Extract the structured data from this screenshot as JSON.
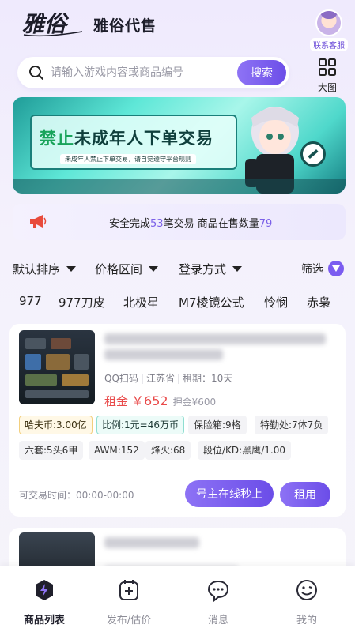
{
  "header": {
    "logo_text": "雅俗",
    "app_title": "雅俗代售",
    "customer_service": "联系客服"
  },
  "search": {
    "placeholder": "请输入游戏内容或商品编号",
    "button": "搜索",
    "view_toggle": "大图"
  },
  "banner": {
    "title_accent": "禁止",
    "title_rest": "未成年人下单交易",
    "subtitle": "未成年人禁止下单交易，请自觉遵守平台规则"
  },
  "notice": {
    "prefix": "安全完成",
    "completed_count": "53",
    "middle": "笔交易 商品在售数量",
    "on_sale_count": "79"
  },
  "filters": {
    "items": [
      "默认排序",
      "价格区间",
      "登录方式"
    ],
    "screen": "筛选"
  },
  "tags": [
    "977",
    "977刀皮",
    "北极星",
    "M7棱镜公式",
    "怜悯",
    "赤枭"
  ],
  "listing": {
    "meta": [
      "QQ扫码",
      "江苏省",
      "租期：10天"
    ],
    "price_label": "租金",
    "price": "￥652",
    "deposit": "押金¥600",
    "chips": [
      "哈夫币:3.00亿",
      "比例:1元=46万币",
      "保险箱:9格",
      "特勤处:7体7负",
      "六套:5头6甲",
      "AWM:152",
      "烽火:68",
      "段位/KD:黑鹰/1.00"
    ],
    "trade_time": "可交易时间：00:00-00:00",
    "btn_online": "号主在线秒上",
    "btn_rent": "租用"
  },
  "tabbar": [
    "商品列表",
    "发布/估价",
    "消息",
    "我的"
  ],
  "colors": {
    "accent": "#7b5cf0",
    "price": "#e94a4a",
    "banner_green": "#18a35a"
  }
}
